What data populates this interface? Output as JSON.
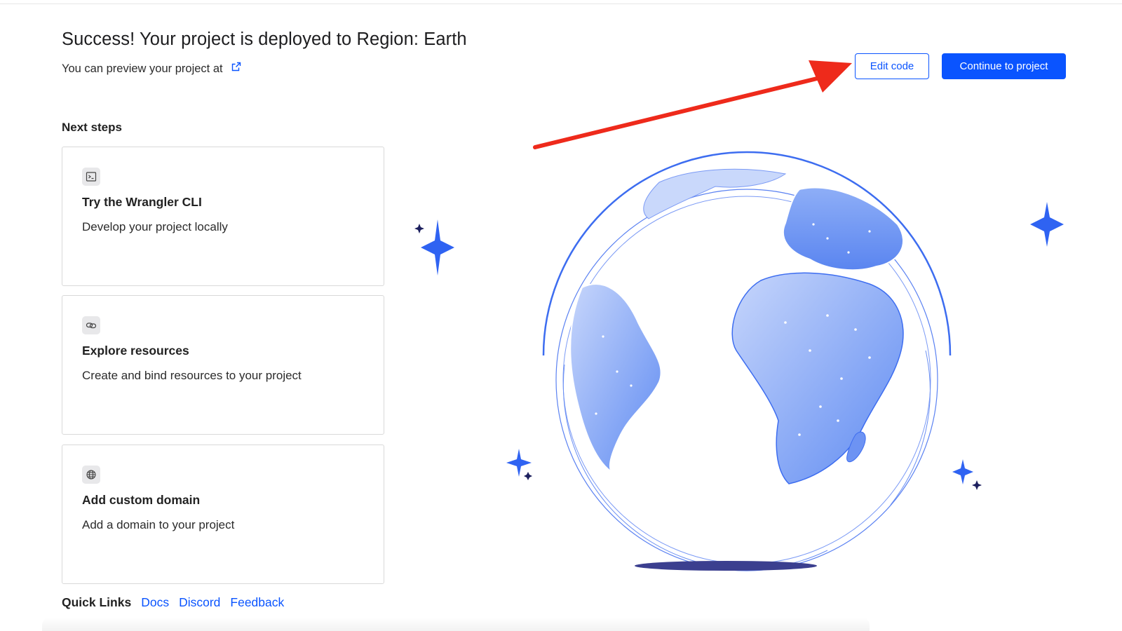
{
  "header": {
    "title": "Success! Your project is deployed to Region: Earth",
    "preview_text": "You can preview your project at",
    "external_link_icon": "external-link-icon"
  },
  "actions": {
    "edit_code_label": "Edit code",
    "continue_label": "Continue to project"
  },
  "next_steps": {
    "heading": "Next steps",
    "cards": [
      {
        "icon": "terminal-icon",
        "title": "Try the Wrangler CLI",
        "description": "Develop your project locally"
      },
      {
        "icon": "link-icon",
        "title": "Explore resources",
        "description": "Create and bind resources to your project"
      },
      {
        "icon": "globe-icon",
        "title": "Add custom domain",
        "description": "Add a domain to your project"
      }
    ]
  },
  "quick_links": {
    "label": "Quick Links",
    "links": [
      "Docs",
      "Discord",
      "Feedback"
    ]
  },
  "colors": {
    "accent": "#0a54ff",
    "annotation_arrow": "#ee2a1b",
    "globe_fill": "#7aa0f5",
    "globe_outline": "#3d6df0",
    "sparkle": "#2f63f2",
    "sparkle_dark": "#1c1f5e",
    "shadow": "#3b3f8f"
  }
}
